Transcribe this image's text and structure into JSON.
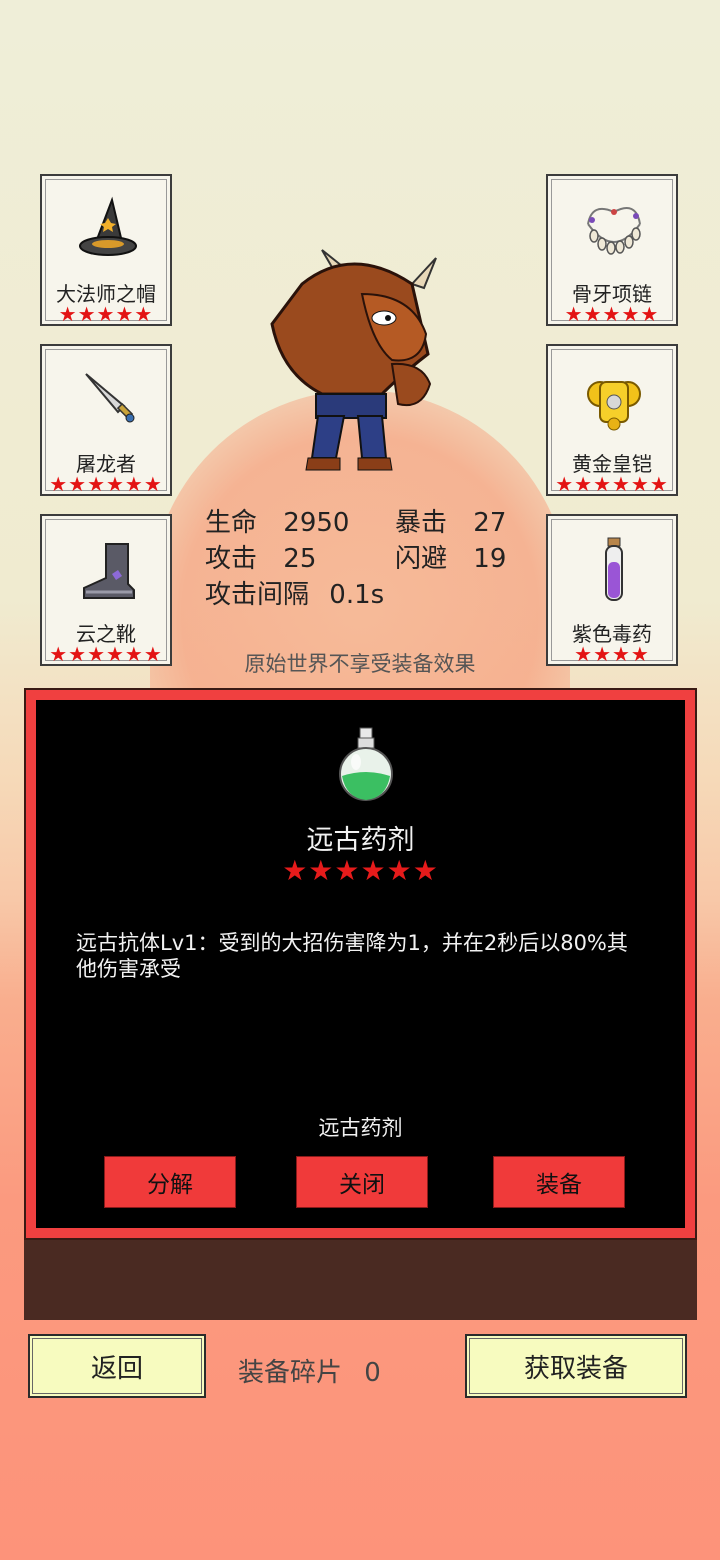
{
  "slots": {
    "hat": {
      "name": "大法师之帽",
      "stars": "★★★★★",
      "icon": "wizard-hat-icon"
    },
    "sword": {
      "name": "屠龙者",
      "stars": "★★★★★★",
      "icon": "dagger-icon"
    },
    "boots": {
      "name": "云之靴",
      "stars": "★★★★★★",
      "icon": "boot-icon"
    },
    "necklace": {
      "name": "骨牙项链",
      "stars": "★★★★★",
      "icon": "necklace-icon"
    },
    "armor": {
      "name": "黄金皇铠",
      "stars": "★★★★★★",
      "icon": "golden-armor-icon"
    },
    "poison": {
      "name": "紫色毒药",
      "stars": "★★★★",
      "icon": "purple-vial-icon"
    }
  },
  "stats": {
    "hp_label": "生命",
    "hp_value": "2950",
    "crit_label": "暴击",
    "crit_value": "27",
    "atk_label": "攻击",
    "atk_value": "25",
    "dodge_label": "闪避",
    "dodge_value": "19",
    "interval_label": "攻击间隔",
    "interval_value": "0.1s"
  },
  "note": "原始世界不享受装备效果",
  "item": {
    "title": "远古药剂",
    "stars": "★★★★★★",
    "description": "远古抗体Lv1：受到的大招伤害降为1，并在2秒后以80%其他伤害承受",
    "label": "远古药剂",
    "icon": "green-potion-icon"
  },
  "buttons": {
    "decompose": "分解",
    "close": "关闭",
    "equip": "装备",
    "back": "返回",
    "get_equipment": "获取装备"
  },
  "shards": {
    "label": "装备碎片",
    "value": "0"
  },
  "colors": {
    "accent_red": "#f03a3a",
    "button_yellow": "#f7fbbf",
    "star_red": "#e31414"
  }
}
